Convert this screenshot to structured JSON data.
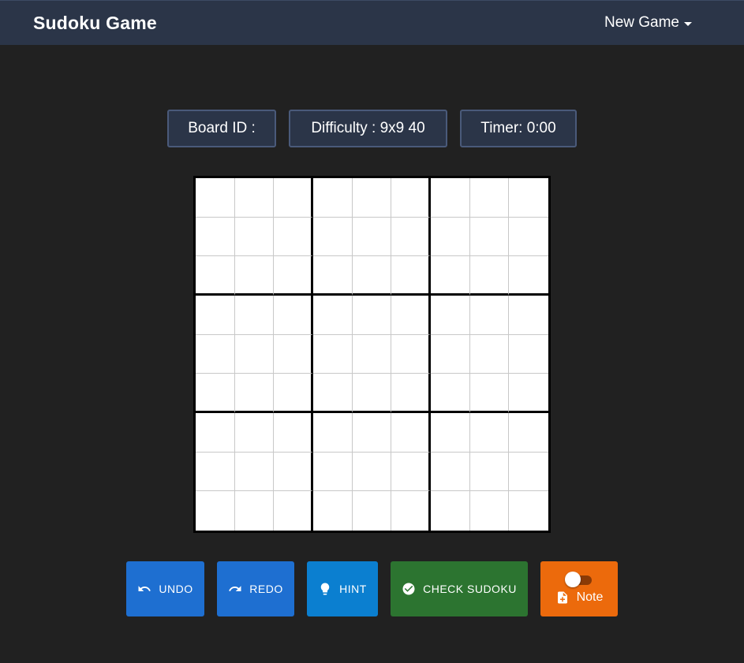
{
  "navbar": {
    "brand": "Sudoku Game",
    "new_game_label": "New Game"
  },
  "info": {
    "board_id": "Board ID :",
    "difficulty": "Difficulty : 9x9 40",
    "timer": "Timer: 0:00"
  },
  "board": {
    "size": 9,
    "cells": [
      [
        "",
        "",
        "",
        "",
        "",
        "",
        "",
        "",
        ""
      ],
      [
        "",
        "",
        "",
        "",
        "",
        "",
        "",
        "",
        ""
      ],
      [
        "",
        "",
        "",
        "",
        "",
        "",
        "",
        "",
        ""
      ],
      [
        "",
        "",
        "",
        "",
        "",
        "",
        "",
        "",
        ""
      ],
      [
        "",
        "",
        "",
        "",
        "",
        "",
        "",
        "",
        ""
      ],
      [
        "",
        "",
        "",
        "",
        "",
        "",
        "",
        "",
        ""
      ],
      [
        "",
        "",
        "",
        "",
        "",
        "",
        "",
        "",
        ""
      ],
      [
        "",
        "",
        "",
        "",
        "",
        "",
        "",
        "",
        ""
      ],
      [
        "",
        "",
        "",
        "",
        "",
        "",
        "",
        "",
        ""
      ]
    ]
  },
  "controls": {
    "undo": {
      "label": "UNDO",
      "icon": "undo-icon",
      "color": "#1e6fd1"
    },
    "redo": {
      "label": "REDO",
      "icon": "redo-icon",
      "color": "#1e6fd1"
    },
    "hint": {
      "label": "HINT",
      "icon": "lightbulb-icon",
      "color": "#0b7fd0"
    },
    "check": {
      "label": "CHECK SUDOKU",
      "icon": "check-circle-icon",
      "color": "#2c7430"
    },
    "note": {
      "label": "Note",
      "icon": "note-add-icon",
      "color": "#ec6a0c",
      "toggle_on": false
    }
  },
  "colors": {
    "background": "#212121",
    "navbar": "#2b3548",
    "info_border": "#4a5a7a"
  }
}
